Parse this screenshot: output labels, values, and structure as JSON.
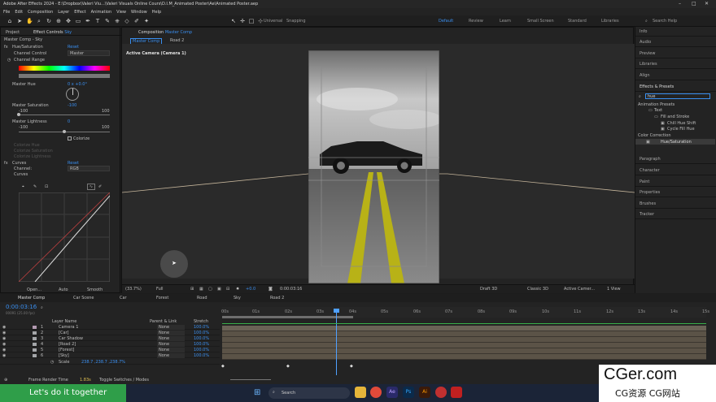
{
  "titlebar": {
    "title": "Adobe After Effects 2024 - E:\\Dropbox\\Valeri Viu...\\Valeri Visuals Online Cours\\D.I.M_Animated Poster\\Ae\\Animated Poster.aep"
  },
  "menu": [
    "File",
    "Edit",
    "Composition",
    "Layer",
    "Effect",
    "Animation",
    "View",
    "Window",
    "Help"
  ],
  "toolbar": {
    "universal": "Universal",
    "snapping": "Snapping",
    "workspaces": [
      "Default",
      "Review",
      "Learn",
      "Small Screen",
      "Standard",
      "Libraries"
    ],
    "search": "Search Help"
  },
  "left_tabs": {
    "project": "Project",
    "effect_controls": "Effect Controls",
    "layer_name": "Sky"
  },
  "effect_controls": {
    "header": "Master Comp - Sky",
    "hue_sat": {
      "name": "Hue/Saturation",
      "reset": "Reset",
      "channel_control": "Channel Control",
      "channel_value": "Master",
      "channel_range": "Channel Range",
      "master_hue": "Master Hue",
      "hue_value": "0 x +0.0°",
      "master_saturation": "Master Saturation",
      "sat_value": "-100",
      "sat_min": "-100",
      "sat_max": "100",
      "master_lightness": "Master Lightness",
      "light_value": "0",
      "light_min": "-100",
      "light_max": "100",
      "colorize": "Colorize",
      "colorize_hue": "Colorize Hue",
      "colorize_saturation": "Colorize Saturation",
      "colorize_lightness": "Colorize Lightness"
    },
    "curves": {
      "name": "Curves",
      "reset": "Reset",
      "channel": "Channel:",
      "channel_value": "RGB",
      "curves_label": "Curves",
      "buttons": [
        "Open...",
        "Auto",
        "Smooth"
      ]
    }
  },
  "composition": {
    "tab": "Composition",
    "comp_name": "Master Comp",
    "sub_tabs": [
      "Master Comp",
      "Road 2"
    ],
    "camera_label": "Active Camera (Camera 1)"
  },
  "viewer_footer": {
    "zoom": "(33.7%)",
    "quality": "Full",
    "exposure": "+0.0",
    "timecode": "0:00:03:16",
    "renderer": "Draft 3D",
    "renderer_mode": "Classic 3D",
    "camera": "Active Camer...",
    "views": "1 View"
  },
  "right_panels": {
    "top": [
      "Info",
      "Audio",
      "Preview",
      "Libraries",
      "Align"
    ],
    "effects_presets": "Effects & Presets",
    "search": "hue",
    "tree": [
      "Animation Presets",
      "Text",
      "Fill and Stroke",
      "Chill Hue Shift",
      "Cycle Fill Hue",
      "Color Correction",
      "Hue/Saturation"
    ],
    "bottom": [
      "Paragraph",
      "Character",
      "Paint",
      "Properties",
      "Brushes",
      "Tracker"
    ]
  },
  "timeline": {
    "tabs": [
      "Master Comp",
      "Car Scene",
      "Car",
      "Forest",
      "Road",
      "Sky",
      "Road 2"
    ],
    "timecode": "0:00:03:16",
    "timecode_sub": "00091 (25.00 fps)",
    "columns": {
      "layer_name": "Layer Name",
      "parent": "Parent & Link",
      "stretch": "Stretch"
    },
    "layers": [
      {
        "num": "1",
        "name": "Camera 1",
        "parent": "None",
        "stretch": "100.0%",
        "color": "#b39ab1"
      },
      {
        "num": "2",
        "name": "[Car]",
        "parent": "None",
        "stretch": "100.0%",
        "color": "#a4a6a9"
      },
      {
        "num": "3",
        "name": "Car Shadow",
        "parent": "None",
        "stretch": "100.0%",
        "color": "#a4a6a9"
      },
      {
        "num": "4",
        "name": "[Road 2]",
        "parent": "None",
        "stretch": "100.0%",
        "color": "#a4a6a9"
      },
      {
        "num": "5",
        "name": "[Forest]",
        "parent": "None",
        "stretch": "100.0%",
        "color": "#a4a6a9"
      },
      {
        "num": "6",
        "name": "[Sky]",
        "parent": "None",
        "stretch": "100.0%",
        "color": "#a4a6a9"
      }
    ],
    "scale_label": "Scale",
    "scale_value": "238.7 ,238.7 ,238.7%",
    "ruler": [
      "00s",
      "01s",
      "02s",
      "03s",
      "04s",
      "05s",
      "06s",
      "07s",
      "08s",
      "09s",
      "10s",
      "11s",
      "12s",
      "13s",
      "14s",
      "15s"
    ],
    "frame_render": "Frame Render Time",
    "frame_render_value": "1.83s",
    "toggle": "Toggle Switches / Modes"
  },
  "taskbar": {
    "banner": "Let's do it together",
    "search": "Search"
  },
  "watermark": {
    "line1": "CGer.com",
    "line2": "CG资源 CG网站"
  },
  "colors": {
    "accent": "#3a8ff0",
    "banner": "#2f9e49",
    "track": "#5b5347",
    "playhead": "#4fa0ff"
  }
}
